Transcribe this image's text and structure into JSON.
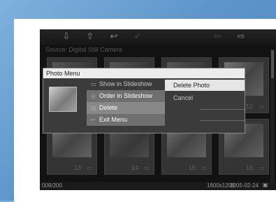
{
  "toolbar": {
    "icons": [
      "arrow-down-icon",
      "arrow-up-icon",
      "back-icon",
      "check-icon",
      "left-arrow-icon",
      "right-arrow-icon"
    ]
  },
  "source_label": "Source: Digital Still Camera",
  "tiles_bottom": [
    {
      "number": "13"
    },
    {
      "number": "14"
    },
    {
      "number": "15"
    },
    {
      "number": "16"
    }
  ],
  "tile_12_number": "12",
  "status": {
    "count": "009/200",
    "resolution": "1600x1200",
    "date": "2005-02-24"
  },
  "menu": {
    "title": "Photo Menu",
    "items": [
      {
        "label": "Show in Slideshow"
      },
      {
        "label": "Order in Slideshow"
      },
      {
        "label": "Delete"
      },
      {
        "label": "Exit Menu"
      }
    ],
    "submenu": [
      {
        "label": "Delete Photo"
      },
      {
        "label": "Cancel"
      }
    ]
  },
  "colors": {
    "background": "#5e96cb",
    "screen": "#1d1d1d",
    "menu_title_bg": "#ececec",
    "selected_item": "#e6e6e6"
  }
}
